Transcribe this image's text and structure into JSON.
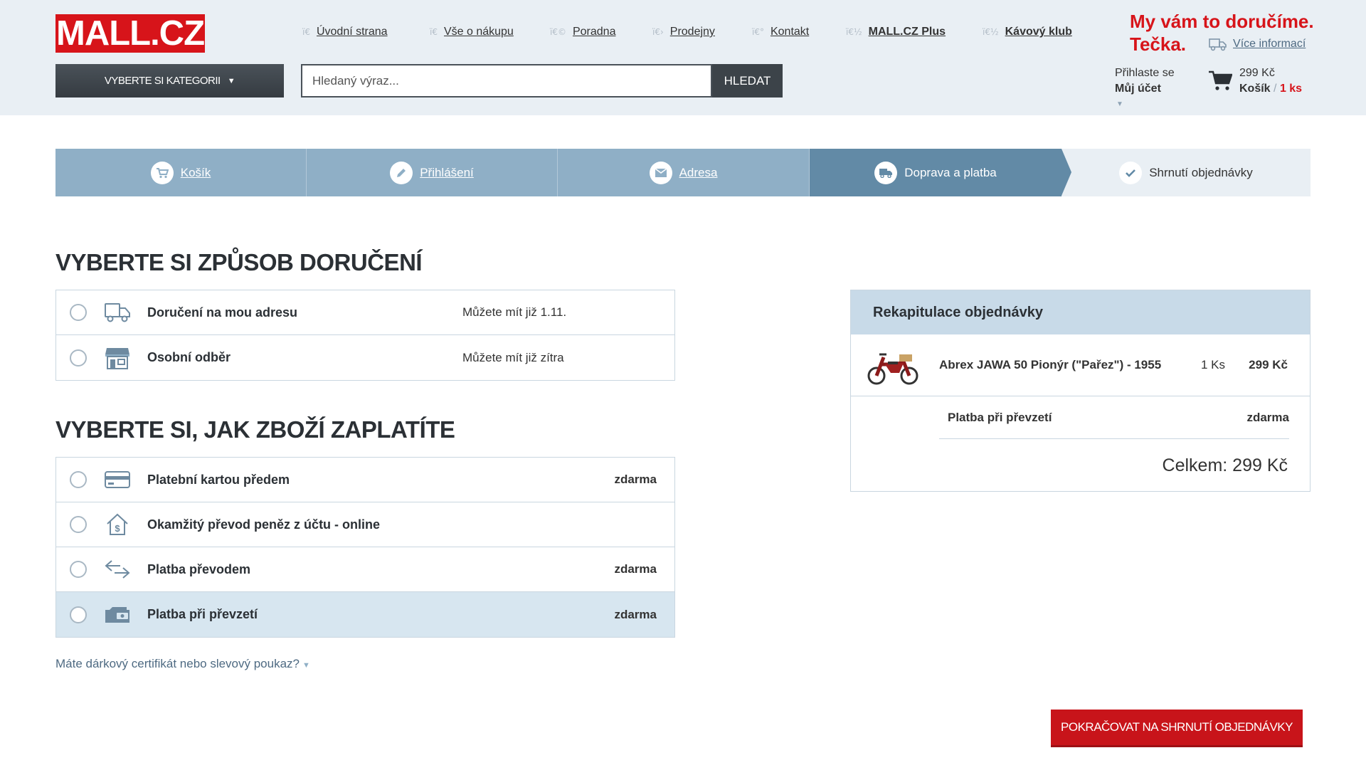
{
  "header": {
    "logo": "MALL.CZ",
    "nav": [
      {
        "icon": "ï€",
        "label": "Úvodní strana",
        "bold": false
      },
      {
        "icon": "ï€",
        "label": "Vše o nákupu",
        "bold": false
      },
      {
        "icon": "ï€©",
        "label": "Poradna",
        "bold": false
      },
      {
        "icon": "ï€›",
        "label": "Prodejny",
        "bold": false
      },
      {
        "icon": "ï€°",
        "label": "Kontakt",
        "bold": false
      },
      {
        "icon": "ï€½",
        "label": "MALL.CZ Plus",
        "bold": true
      },
      {
        "icon": "ï€½",
        "label": "Kávový klub",
        "bold": true
      }
    ],
    "promo_line1": "My vám to doručíme.",
    "promo_line2": "Tečka.",
    "promo_more": "Více informací",
    "category_button": "VYBERTE SI KATEGORII",
    "search_placeholder": "Hledaný výraz...",
    "search_button": "HLEDAT",
    "login_prompt": "Přihlaste se",
    "account_label": "Můj účet",
    "cart_price": "299 Kč",
    "cart_label": "Košík",
    "cart_separator": "/",
    "cart_count": "1 ks"
  },
  "steps": [
    {
      "label": "Košík",
      "icon": "cart-icon"
    },
    {
      "label": "Přihlášení",
      "icon": "pencil-icon"
    },
    {
      "label": "Adresa",
      "icon": "envelope-icon"
    },
    {
      "label": "Doprava a platba",
      "icon": "truck-icon"
    },
    {
      "label": "Shrnutí objednávky",
      "icon": "check-icon"
    }
  ],
  "delivery": {
    "title": "VYBERTE SI ZPŮSOB DORUČENÍ",
    "options": [
      {
        "label": "Doručení na mou adresu",
        "note": "Můžete mít již 1.11.",
        "icon": "truck-icon"
      },
      {
        "label": "Osobní odběr",
        "note": "Můžete mít již zítra",
        "icon": "store-icon"
      }
    ]
  },
  "payment": {
    "title": "VYBERTE SI, JAK ZBOŽÍ ZAPLATÍTE",
    "options": [
      {
        "label": "Platební kartou předem",
        "price": "zdarma",
        "icon": "credit-card-icon"
      },
      {
        "label": "Okamžitý převod peněz z účtu - online",
        "price": "",
        "icon": "house-dollar-icon"
      },
      {
        "label": "Platba převodem",
        "price": "zdarma",
        "icon": "transfer-arrows-icon"
      },
      {
        "label": "Platba při převzetí",
        "price": "zdarma",
        "icon": "cash-icon"
      }
    ]
  },
  "voucher_link": "Máte dárkový certifikát nebo slevový poukaz?",
  "recap": {
    "title": "Rekapitulace objednávky",
    "item_name": "Abrex JAWA 50 Pionýr (\"Pařez\") - 1955",
    "item_qty": "1 Ks",
    "item_price": "299 Kč",
    "payment_label": "Platba při převzetí",
    "payment_price": "zdarma",
    "total": "Celkem: 299 Kč"
  },
  "continue_button": "POKRAČOVAT NA SHRNUTÍ OBJEDNÁVKY",
  "colors": {
    "brand_red": "#d7141a",
    "header_bg": "#e9eff4",
    "step_done": "#8fafc6",
    "step_current": "#628aa6",
    "selected_row": "#d7e6f0"
  }
}
